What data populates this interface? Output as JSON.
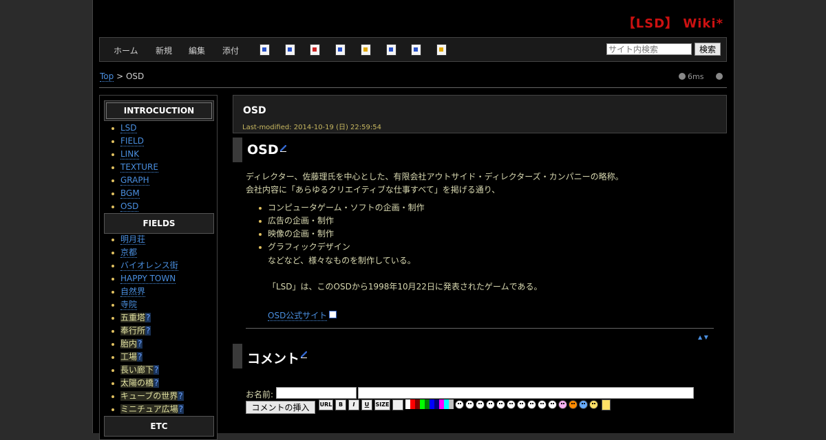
{
  "site": {
    "title": "【LSD】 Wiki*"
  },
  "nav": {
    "links": [
      "ホーム",
      "新規",
      "編集",
      "添付"
    ],
    "tool_icons": [
      "copy-page-icon",
      "search-replace-icon",
      "diff-icon",
      "backup-icon",
      "freeze-icon",
      "rename-icon",
      "new-subpage-icon",
      "help-icon"
    ],
    "search_placeholder": "サイト内検索",
    "search_button": "検索"
  },
  "breadcrumb": {
    "top": "Top",
    "separator": ">",
    "current": "OSD"
  },
  "stats": {
    "time": "6ms"
  },
  "sidebar": {
    "sections": [
      {
        "title": "INTROCUCTION",
        "items": [
          "LSD",
          "FIELD",
          "LINK",
          "TEXTURE",
          "GRAPH",
          "BGM",
          "OSD"
        ]
      },
      {
        "title": "FIELDS",
        "items": [
          "明月荘",
          "京都",
          "バイオレンス街",
          "HAPPY TOWN",
          "自然界",
          "寺院"
        ],
        "missing_items": [
          "五重塔",
          "奉行所",
          "胎内",
          "工場",
          "長い廊下",
          "太陽の橋",
          "キューブの世界",
          "ミニチュア広場"
        ],
        "missing_marker": "?"
      },
      {
        "title": "ETC"
      }
    ]
  },
  "content": {
    "page_title": "OSD",
    "last_modified": "Last-modified: 2014-10-19 (日) 22:59:54",
    "section1": {
      "heading": "OSD",
      "line1": "ディレクター、佐藤理氏を中心とした、有限会社アウトサイド・ディレクターズ・カンパニーの略称。",
      "line2": "会社内容に「あらゆるクリエイティブな仕事すべて」を掲げる通り、",
      "bullets": [
        "コンピュータゲーム・ソフトの企画・制作",
        "広告の企画・制作",
        "映像の企画・制作",
        "グラフィックデザイン"
      ],
      "line3": "などなど、様々なものを制作している。",
      "line4": "「LSD」は、このOSDから1998年10月22日に発表されたゲームである。",
      "link": "OSD公式サイト"
    },
    "up_down": "▲ ▼",
    "section2": {
      "heading": "コメント",
      "name_label": "お名前:",
      "submit": "コメントの挿入",
      "format_buttons": [
        "URL",
        "B",
        "I",
        "U",
        "SIZE"
      ]
    }
  },
  "colors": {
    "accent_title": "#cc1111",
    "link": "#4a8fe0",
    "text": "#d8d8b0",
    "swatches": [
      "#ffffff",
      "#ff0000",
      "#800000",
      "#00ff00",
      "#008000",
      "#0000ff",
      "#000080",
      "#ff00ff",
      "#00ffff",
      "#c0c0c0"
    ]
  }
}
